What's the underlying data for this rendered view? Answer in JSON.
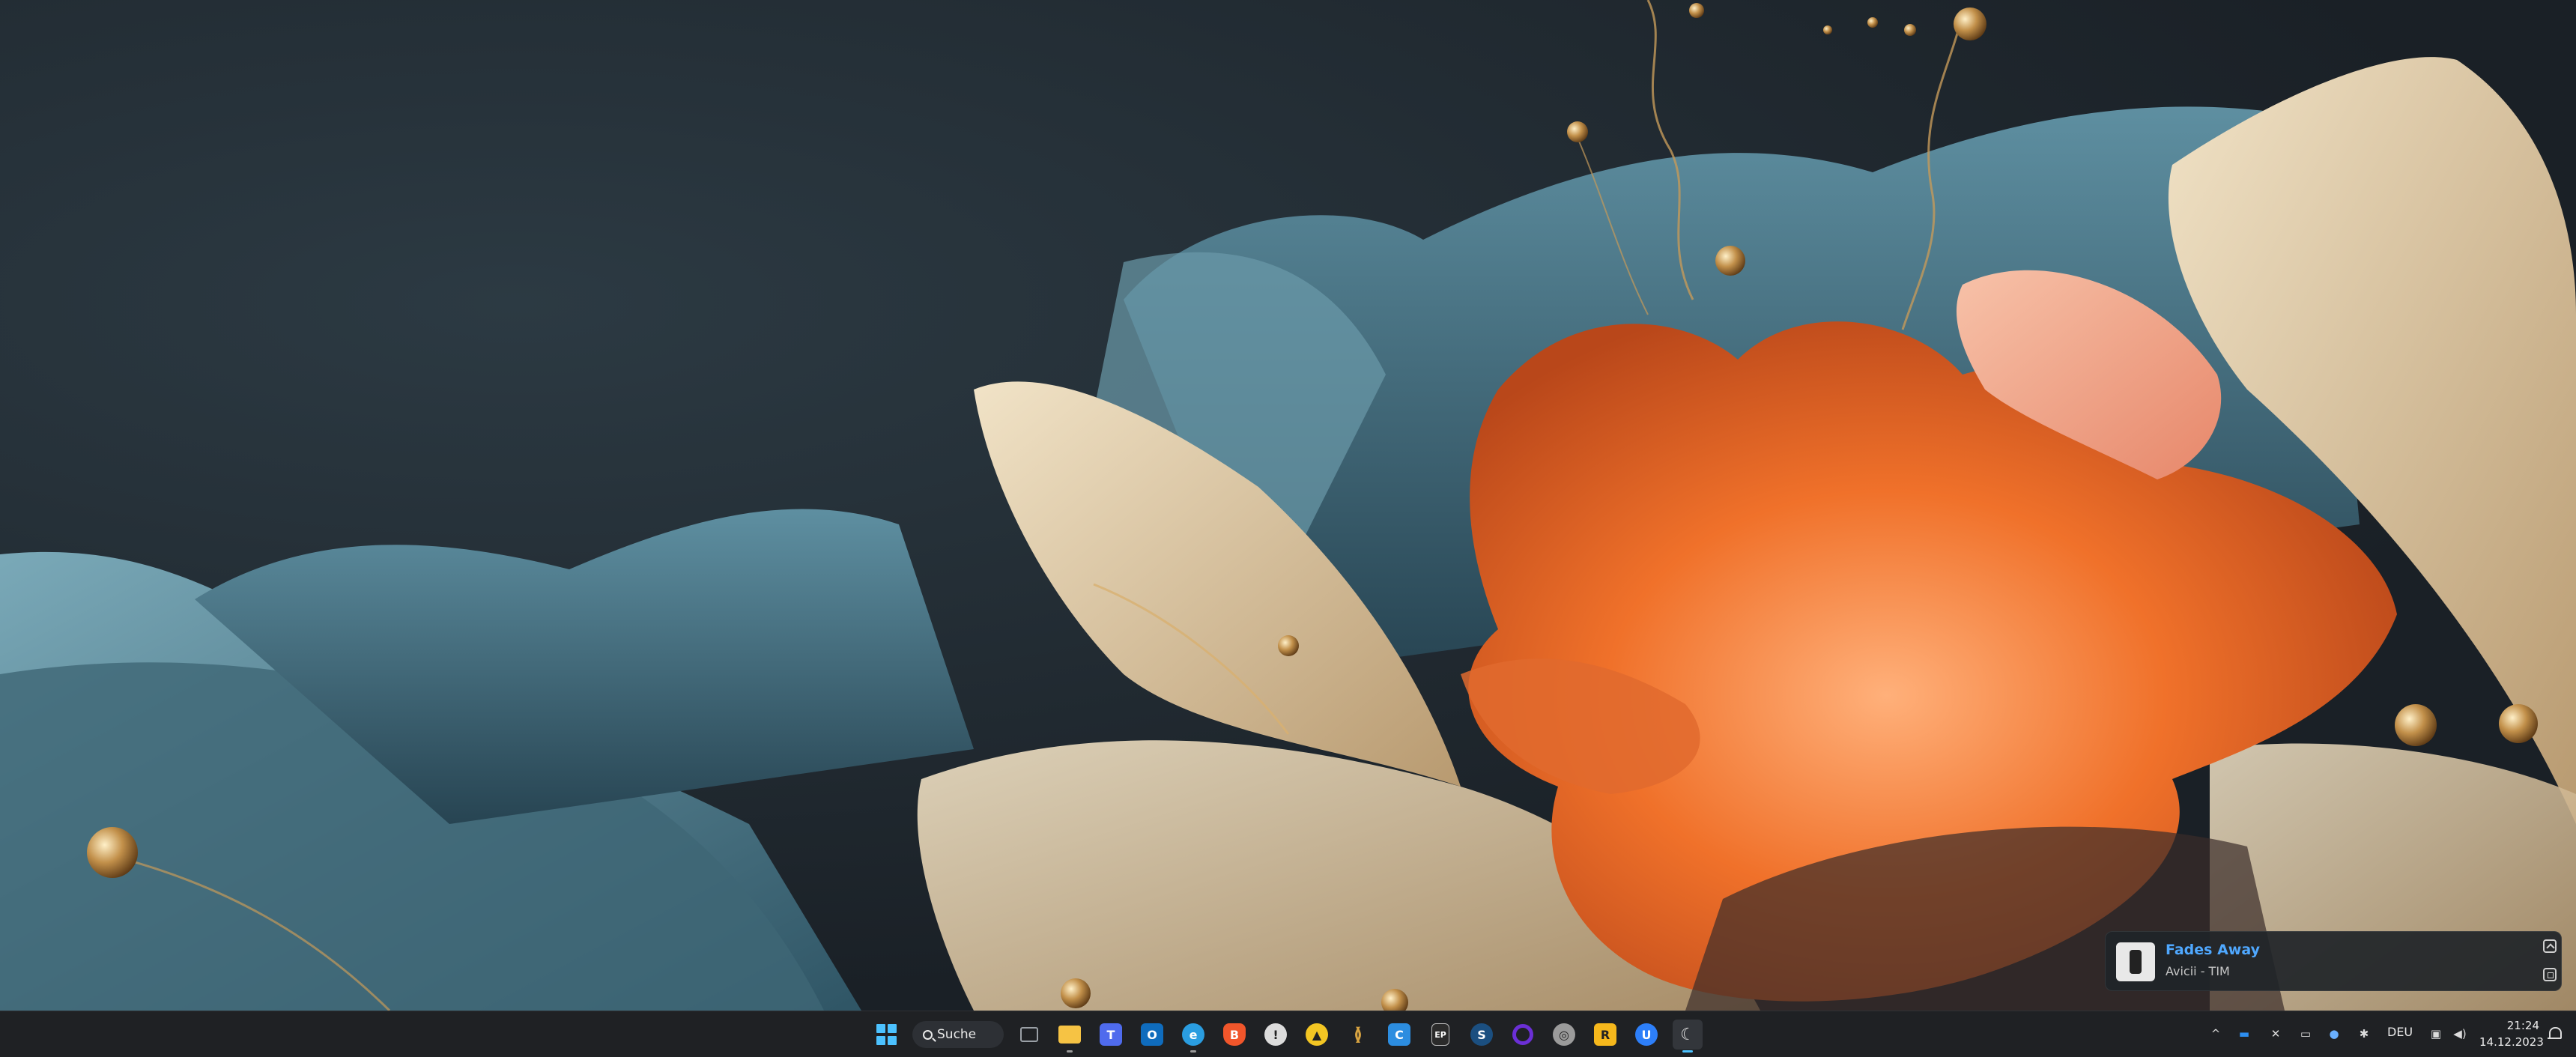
{
  "media": {
    "title": "Fades Away",
    "artist": "Avicii - TIM"
  },
  "taskbar": {
    "search_label": "Suche",
    "apps": [
      {
        "id": "start",
        "icon": "windows-start-icon"
      },
      {
        "id": "task-view",
        "icon": "task-view-icon",
        "color": "#9aa0a6"
      },
      {
        "id": "file-explorer",
        "icon": "folder-icon",
        "color": "#f6c344"
      },
      {
        "id": "teams",
        "icon": "teams-icon",
        "color": "#4f6bed",
        "glyph": "T"
      },
      {
        "id": "outlook",
        "icon": "outlook-icon",
        "color": "#0f6cbd",
        "glyph": "O"
      },
      {
        "id": "edge",
        "icon": "edge-icon",
        "color": "#2a9de0",
        "glyph": "e"
      },
      {
        "id": "brave",
        "icon": "brave-icon",
        "color": "#f1562b",
        "glyph": "B"
      },
      {
        "id": "app-circle",
        "icon": "app-circle-icon",
        "color": "#dcdcdc",
        "glyph": "!"
      },
      {
        "id": "triangle-app",
        "icon": "triangle-app-icon",
        "color": "#f3c623",
        "glyph": "▲"
      },
      {
        "id": "audio-app",
        "icon": "audio-app-icon",
        "color": "#d9a441",
        "glyph": "≬"
      },
      {
        "id": "c-app",
        "icon": "c-app-icon",
        "color": "#2c8de0",
        "glyph": "C"
      },
      {
        "id": "epic",
        "icon": "epic-games-icon",
        "color": "#2b2b2b",
        "glyph": "EP"
      },
      {
        "id": "steam",
        "icon": "steam-icon",
        "color": "#1b4f80",
        "glyph": "S"
      },
      {
        "id": "purple-ring",
        "icon": "ring-app-icon",
        "color": "#6b2fd6",
        "glyph": "○"
      },
      {
        "id": "gog",
        "icon": "gog-icon",
        "color": "#9b9b9b",
        "glyph": "◎"
      },
      {
        "id": "rockstar",
        "icon": "rockstar-icon",
        "color": "#f6b81c",
        "glyph": "R"
      },
      {
        "id": "ubisoft",
        "icon": "ubisoft-icon",
        "color": "#2d7ff9",
        "glyph": "U"
      },
      {
        "id": "active-app",
        "icon": "active-app-icon",
        "color": "#e4e4e4",
        "glyph": "☾"
      }
    ]
  },
  "tray": {
    "language": "DEU",
    "time": "21:24",
    "date": "14.12.2023"
  }
}
